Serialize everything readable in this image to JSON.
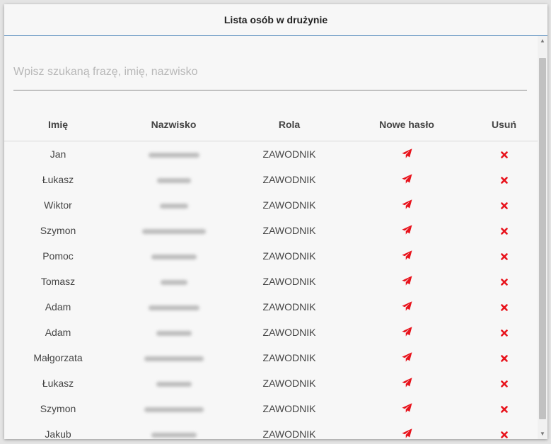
{
  "dialog": {
    "title": "Lista osób w drużynie"
  },
  "search": {
    "placeholder": "Wpisz szukaną frazę, imię, nazwisko",
    "value": ""
  },
  "table": {
    "headers": {
      "first_name": "Imię",
      "last_name": "Nazwisko",
      "role": "Rola",
      "new_password": "Nowe hasło",
      "delete": "Usuń"
    },
    "rows": [
      {
        "first_name": "Jan",
        "role": "ZAWODNIK"
      },
      {
        "first_name": "Łukasz",
        "role": "ZAWODNIK"
      },
      {
        "first_name": "Wiktor",
        "role": "ZAWODNIK"
      },
      {
        "first_name": "Szymon",
        "role": "ZAWODNIK"
      },
      {
        "first_name": "Pomoc",
        "role": "ZAWODNIK"
      },
      {
        "first_name": "Tomasz",
        "role": "ZAWODNIK"
      },
      {
        "first_name": "Adam",
        "role": "ZAWODNIK"
      },
      {
        "first_name": "Adam",
        "role": "ZAWODNIK"
      },
      {
        "first_name": "Małgorzata",
        "role": "ZAWODNIK"
      },
      {
        "first_name": "Łukasz",
        "role": "ZAWODNIK"
      },
      {
        "first_name": "Szymon",
        "role": "ZAWODNIK"
      },
      {
        "first_name": "Jakub",
        "role": "ZAWODNIK"
      }
    ]
  },
  "icons": {
    "new_password": "send-icon",
    "delete": "close-icon"
  },
  "colors": {
    "accent": "#e8131c",
    "header_border": "#5b8fbf"
  }
}
